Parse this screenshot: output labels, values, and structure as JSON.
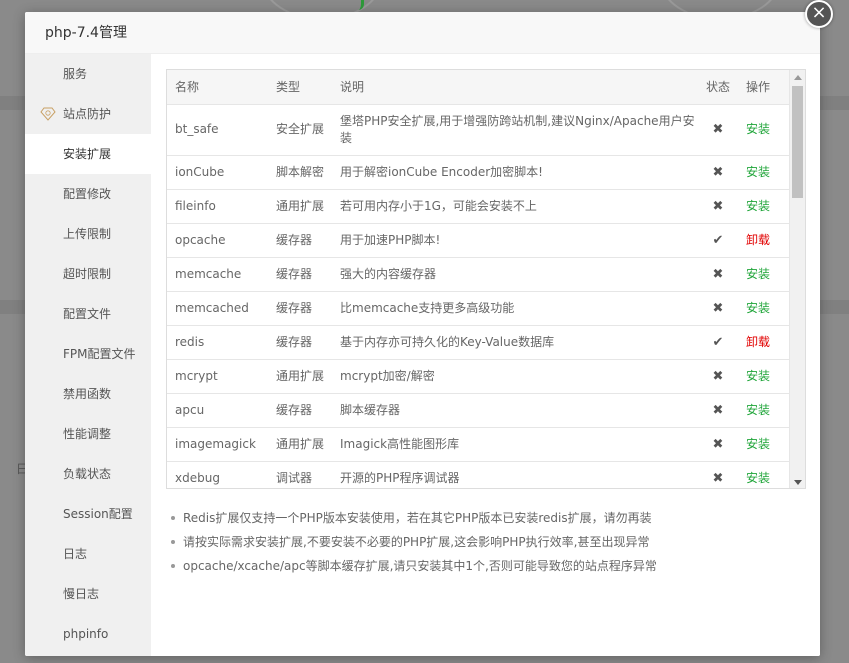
{
  "window": {
    "title": "php-7.4管理",
    "close_label": "×"
  },
  "sidebar": {
    "items": [
      {
        "label": "服务",
        "icon": ""
      },
      {
        "label": "站点防护",
        "icon": "diamond-icon"
      },
      {
        "label": "安装扩展",
        "active": true
      },
      {
        "label": "配置修改"
      },
      {
        "label": "上传限制"
      },
      {
        "label": "超时限制"
      },
      {
        "label": "配置文件"
      },
      {
        "label": "FPM配置文件"
      },
      {
        "label": "禁用函数"
      },
      {
        "label": "性能调整"
      },
      {
        "label": "负载状态"
      },
      {
        "label": "Session配置"
      },
      {
        "label": "日志"
      },
      {
        "label": "慢日志"
      },
      {
        "label": "phpinfo"
      }
    ]
  },
  "table": {
    "headers": [
      "名称",
      "类型",
      "说明",
      "状态",
      "操作"
    ],
    "rows": [
      {
        "name": "bt_safe",
        "type": "安全扩展",
        "desc": "堡塔PHP安全扩展,用于增强防跨站机制,建议Nginx/Apache用户安装",
        "status": "✖",
        "action": "安装"
      },
      {
        "name": "ionCube",
        "type": "脚本解密",
        "desc": "用于解密ionCube Encoder加密脚本!",
        "status": "✖",
        "action": "安装"
      },
      {
        "name": "fileinfo",
        "type": "通用扩展",
        "desc": "若可用内存小于1G，可能会安装不上",
        "status": "✖",
        "action": "安装"
      },
      {
        "name": "opcache",
        "type": "缓存器",
        "desc": "用于加速PHP脚本!",
        "status": "✔",
        "action": "卸载"
      },
      {
        "name": "memcache",
        "type": "缓存器",
        "desc": "强大的内容缓存器",
        "status": "✖",
        "action": "安装"
      },
      {
        "name": "memcached",
        "type": "缓存器",
        "desc": "比memcache支持更多高级功能",
        "status": "✖",
        "action": "安装"
      },
      {
        "name": "redis",
        "type": "缓存器",
        "desc": "基于内存亦可持久化的Key-Value数据库",
        "status": "✔",
        "action": "卸载"
      },
      {
        "name": "mcrypt",
        "type": "通用扩展",
        "desc": "mcrypt加密/解密",
        "status": "✖",
        "action": "安装"
      },
      {
        "name": "apcu",
        "type": "缓存器",
        "desc": "脚本缓存器",
        "status": "✖",
        "action": "安装"
      },
      {
        "name": "imagemagick",
        "type": "通用扩展",
        "desc": "Imagick高性能图形库",
        "status": "✖",
        "action": "安装"
      },
      {
        "name": "xdebug",
        "type": "调试器",
        "desc": "开源的PHP程序调试器",
        "status": "✖",
        "action": "安装"
      }
    ]
  },
  "notes": [
    "Redis扩展仅支持一个PHP版本安装使用，若在其它PHP版本已安装redis扩展，请勿再装",
    "请按实际需求安装扩展,不要安装不必要的PHP扩展,这会影响PHP执行效率,甚至出现异常",
    "opcache/xcache/apc等脚本缓存扩展,请只安装其中1个,否则可能导致您的站点程序异常"
  ],
  "colors": {
    "install": "#20a53a",
    "uninstall": "#e20000"
  },
  "background": {
    "partial_text": "日"
  }
}
